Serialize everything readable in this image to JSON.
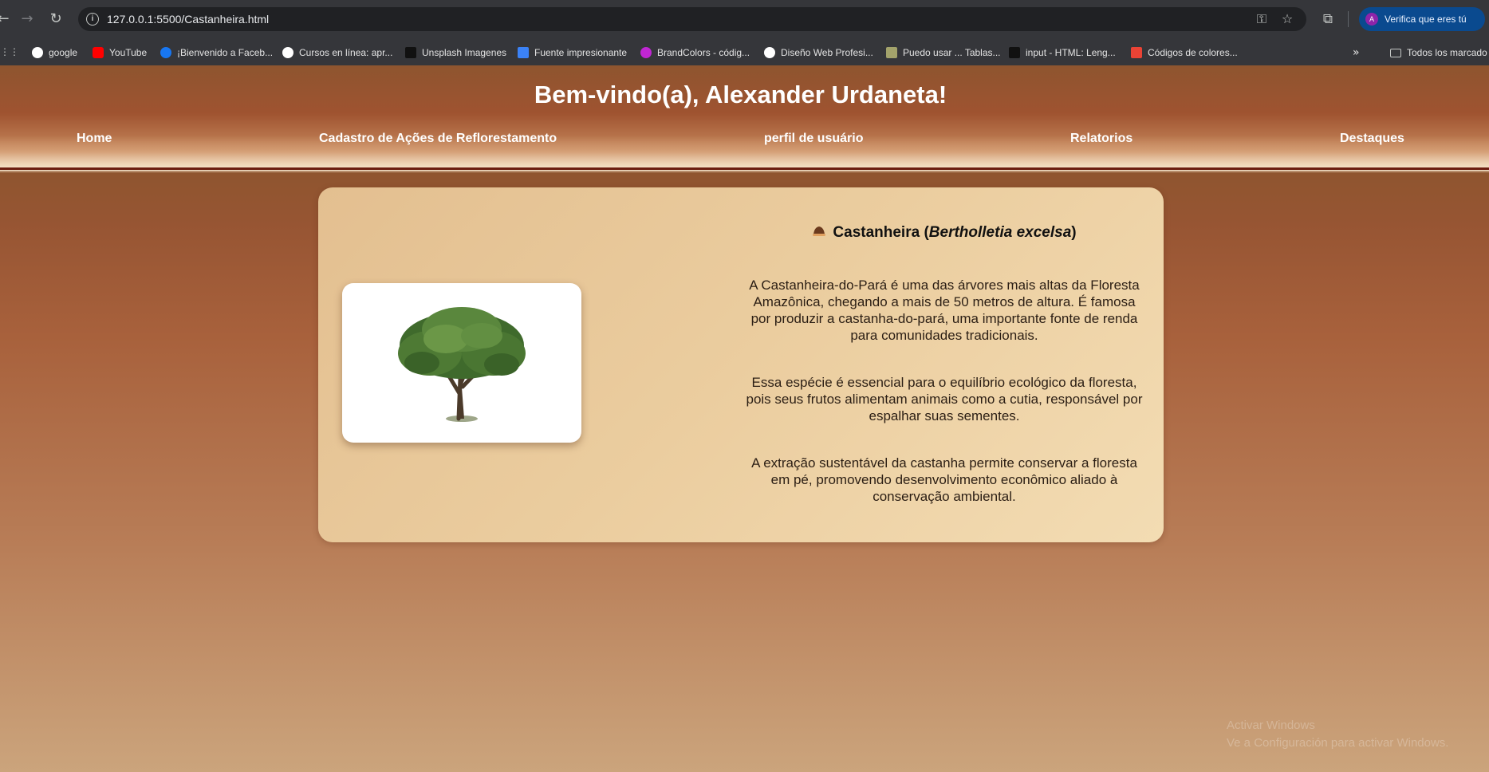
{
  "browser": {
    "url": "127.0.0.1:5500/Castanheira.html",
    "profile_label": "Verifica que eres tú",
    "bookmarks": [
      {
        "label": "google",
        "color": "#ffffff"
      },
      {
        "label": "YouTube",
        "color": "#ff0000"
      },
      {
        "label": "¡Bienvenido a Faceb...",
        "color": "#1877f2"
      },
      {
        "label": "Cursos en línea: apr...",
        "color": "#ffffff"
      },
      {
        "label": "Unsplash Imagenes",
        "color": "#111111"
      },
      {
        "label": "Fuente impresionante",
        "color": "#3b82f6"
      },
      {
        "label": "BrandColors - códig...",
        "color": "#c026d3"
      },
      {
        "label": "Diseño Web Profesi...",
        "color": "#ffffff"
      },
      {
        "label": "Puedo usar ... Tablas...",
        "color": "#a3a36b"
      },
      {
        "label": "input - HTML: Leng...",
        "color": "#111111"
      },
      {
        "label": "Códigos de colores...",
        "color": "#ea4335"
      }
    ],
    "all_bookmarks_label": "Todos los marcado"
  },
  "page": {
    "welcome": "Bem-vindo(a), Alexander Urdaneta!",
    "nav": [
      "Home",
      "Cadastro de Ações de Reflorestamento",
      "perfil de usuário",
      "Relatorios",
      "Destaques"
    ],
    "card": {
      "title_prefix": "Castanheira (",
      "title_scientific": "Bertholletia excelsa",
      "title_suffix": ")",
      "paragraphs": [
        "A Castanheira-do-Pará é uma das árvores mais altas da Floresta Amazônica, chegando a mais de 50 metros de altura. É famosa por produzir a castanha-do-pará, uma importante fonte de renda para comunidades tradicionais.",
        "Essa espécie é essencial para o equilíbrio ecológico da floresta, pois seus frutos alimentam animais como a cutia, responsável por espalhar suas sementes.",
        "A extração sustentável da castanha permite conservar a floresta em pé, promovendo desenvolvimento econômico aliado à conservação ambiental."
      ]
    },
    "watermark": [
      "Activar Windows",
      "Ve a Configuración para activar Windows."
    ]
  }
}
